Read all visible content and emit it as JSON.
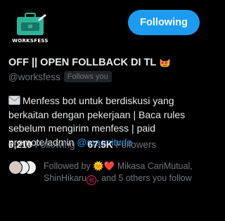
{
  "avatar": {
    "label": "WORKSFESS",
    "colors": {
      "bag": "#2bb39a",
      "bg": "#000000"
    }
  },
  "follow_button": {
    "label": "Following"
  },
  "profile": {
    "display_name": "OFF || OPEN FOLLBACK DI TL",
    "name_emoji": "smiling-cat-heart-eyes",
    "handle": "@worksfess",
    "follows_you_badge": "Follows you"
  },
  "bio": {
    "icon": "envelope-icon",
    "text": "Menfess bot untuk berdiskusi yang berkaitan dengan pekerjaan | Baca rules sebelum mengirim menfess | paid promote/admin",
    "mention": "@magnitvde"
  },
  "stats": {
    "following_count": "6,210",
    "following_label": "Following",
    "followers_count": "67.5K",
    "followers_label": "Followers"
  },
  "followed_by": {
    "prefix": "Followed by",
    "sun": "🌞",
    "heart": "❤️",
    "name1": "Mikasa",
    "name2": "CariMutual,",
    "name3": "ShinHikaru",
    "kanji": "㊗",
    "suffix": ", and 5 others you follow"
  },
  "colors": {
    "accent": "#1d9bf0",
    "text_primary": "#e7e9ea",
    "text_secondary": "#71767b",
    "background": "#000000"
  }
}
